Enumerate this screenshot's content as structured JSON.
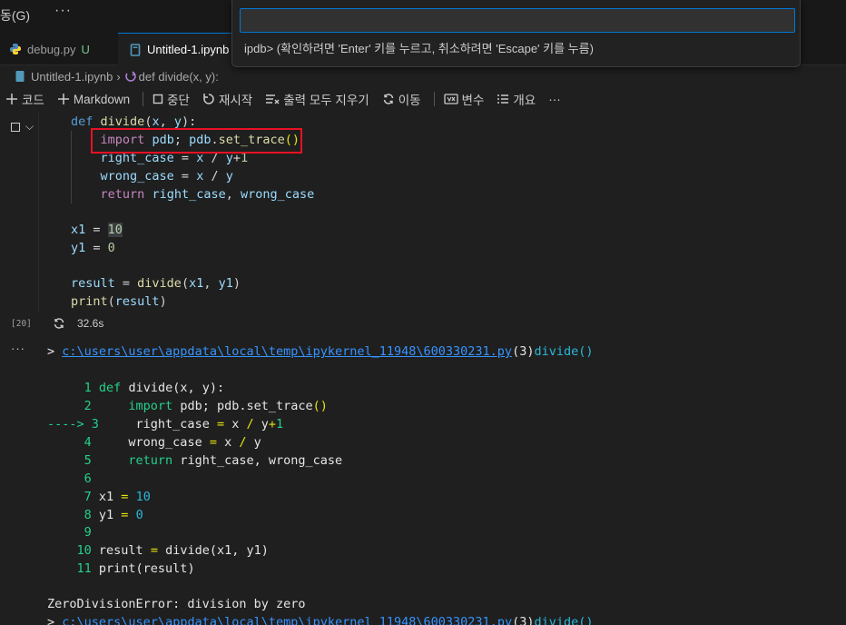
{
  "titlebar": {
    "menu_go": "동(G)",
    "menu_more": "···"
  },
  "tabs": [
    {
      "label": "debug.py",
      "badge": "U"
    },
    {
      "label": "Untitled-1.ipynb"
    }
  ],
  "breadcrumb": {
    "file": "Untitled-1.ipynb",
    "symbol": "def divide(x, y):"
  },
  "toolbar": {
    "add_code": "코드",
    "add_markdown": "Markdown",
    "interrupt": "중단",
    "restart": "재시작",
    "clear_outputs": "출력 모두 지우기",
    "go_to": "이동",
    "variables": "변수",
    "outline": "개요",
    "more": "···"
  },
  "palette": {
    "input_value": "",
    "hint": "ipdb> (확인하려면 'Enter' 키를 누르고, 취소하려면 'Escape' 키를 누름)"
  },
  "cell": {
    "lines": [
      "def divide(x, y):",
      "    import pdb; pdb.set_trace()",
      "    right_case = x / y+1",
      "    wrong_case = x / y",
      "    return right_case, wrong_case",
      "",
      "x1 = 10",
      "y1 = 0",
      "",
      "result = divide(x1, y1)",
      "print(result)"
    ],
    "execution_count": "[20]",
    "duration": "32.6s"
  },
  "output": {
    "more": "···",
    "trace_path": "c:\\users\\user\\appdata\\local\\temp\\ipykernel_11948\\600330231.py",
    "trace_line": "(3)",
    "trace_func": "divide()",
    "arrow": "---->",
    "listing": [
      {
        "n": "1",
        "code": "def divide(x, y):"
      },
      {
        "n": "2",
        "code": "    import pdb; pdb.set_trace()"
      },
      {
        "n": "3",
        "code": "    right_case = x / y+1"
      },
      {
        "n": "4",
        "code": "    wrong_case = x / y"
      },
      {
        "n": "5",
        "code": "    return right_case, wrong_case"
      },
      {
        "n": "6",
        "code": ""
      },
      {
        "n": "7",
        "code": "x1 = 10"
      },
      {
        "n": "8",
        "code": "y1 = 0"
      },
      {
        "n": "9",
        "code": ""
      },
      {
        "n": "10",
        "code": "result = divide(x1, y1)"
      },
      {
        "n": "11",
        "code": "print(result)"
      }
    ],
    "error": "ZeroDivisionError: division by zero",
    "trace2_prefix": ">",
    "trace2_path": "c:\\users\\user\\appdata\\local\\temp\\ipykernel_11948\\600330231.py",
    "trace2_line": "(3)",
    "trace2_func": "divide()"
  },
  "colors": {
    "accent": "#0078d4",
    "highlight_box": "#e81123",
    "link": "#3794ff",
    "debug_green": "#23d18b"
  }
}
